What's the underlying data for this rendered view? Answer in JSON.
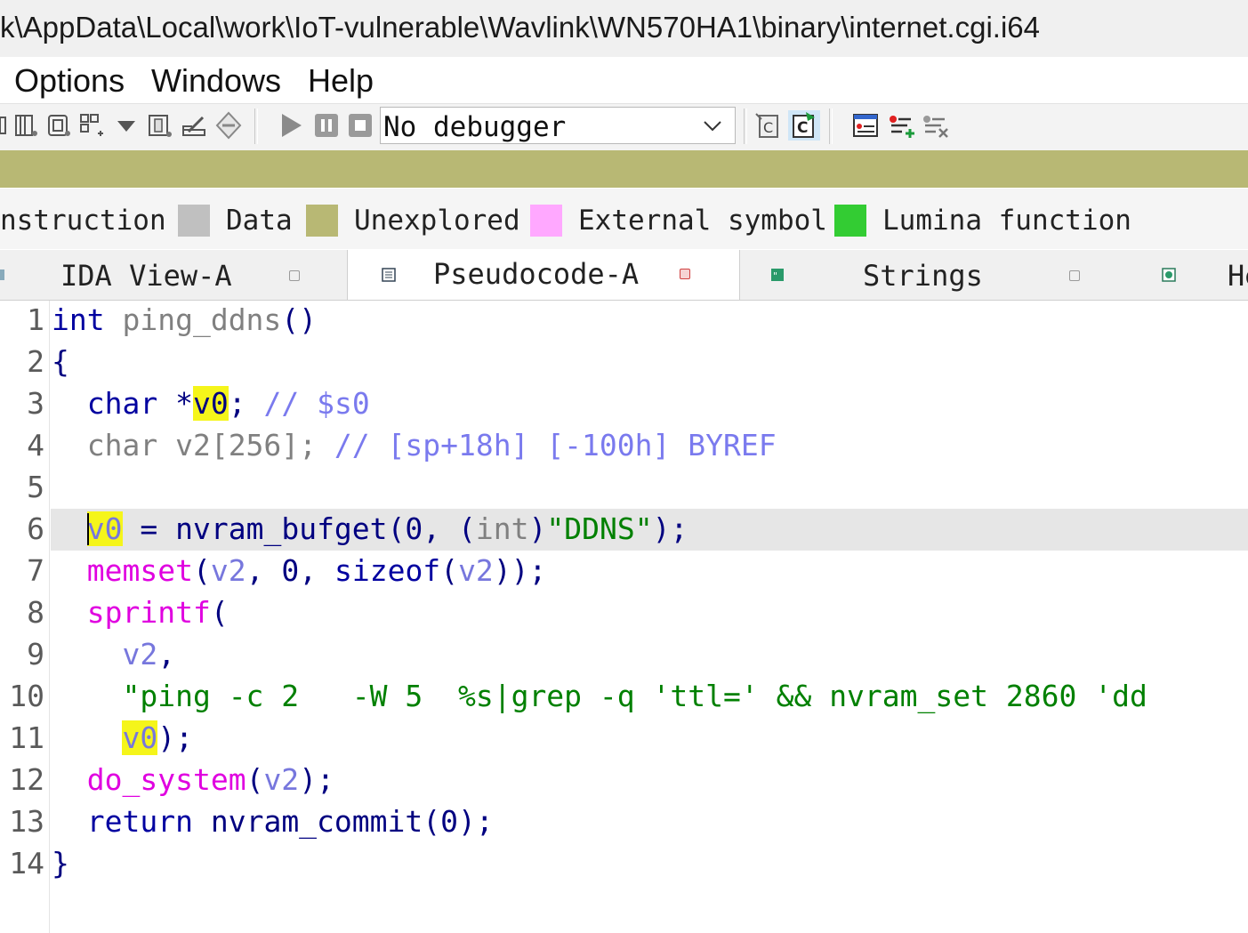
{
  "window": {
    "title": "k\\AppData\\Local\\work\\IoT-vulnerable\\Wavlink\\WN570HA1\\binary\\internet.cgi.i64"
  },
  "menu": [
    "Options",
    "Windows",
    "Help"
  ],
  "toolbar": {
    "debugger_select": "No debugger"
  },
  "legend": {
    "items": [
      {
        "label": "nstruction",
        "color": ""
      },
      {
        "label": "Data",
        "color": "#c0c0c0"
      },
      {
        "label": "Unexplored",
        "color": "#b8b874"
      },
      {
        "label": "External symbol",
        "color": "#ffa8ff"
      },
      {
        "label": "Lumina function",
        "color": "#33cc33"
      }
    ]
  },
  "tabs": [
    {
      "label": "IDA View-A",
      "active": false
    },
    {
      "label": "Pseudocode-A",
      "active": true
    },
    {
      "label": "Strings",
      "active": false
    },
    {
      "label": "He",
      "active": false
    }
  ],
  "code": {
    "line_numbers": [
      "1",
      "2",
      "3",
      "4",
      "5",
      "6",
      "7",
      "8",
      "9",
      "10",
      "11",
      "12",
      "13",
      "14"
    ],
    "l1": {
      "type": "int",
      "name": "ping_ddns",
      "parens": "()"
    },
    "l2": "{",
    "l3": {
      "type": "char",
      "star": "*",
      "var": "v0",
      "semi": ";",
      "comment": "// $s0"
    },
    "l4": {
      "decl": "char v2[256];",
      "comment": "// [sp+18h] [-100h] BYREF"
    },
    "l6": {
      "var": "v0",
      "eq": "=",
      "fn": "nvram_bufget",
      "open": "(",
      "arg0": "0",
      "comma": ",",
      "cast_open": "(",
      "cast": "int",
      "cast_close": ")",
      "str": "\"DDNS\"",
      "close": ");"
    },
    "l7": {
      "fn": "memset",
      "open": "(",
      "a1": "v2",
      "c1": ",",
      "a2": "0",
      "c2": ",",
      "sz": "sizeof",
      "sz_open": "(",
      "a3": "v2",
      "close": "));"
    },
    "l8": {
      "fn": "sprintf",
      "open": "("
    },
    "l9": {
      "arg": "v2",
      "comma": ","
    },
    "l10": {
      "str": "\"ping -c 2   -W 5  %s|grep -q 'ttl=' && nvram_set 2860 'dd"
    },
    "l11": {
      "var": "v0",
      "close": ");"
    },
    "l12": {
      "fn": "do_system",
      "open": "(",
      "arg": "v2",
      "close": ");"
    },
    "l13": {
      "kw": "return",
      "fn": "nvram_commit",
      "args": "(0);"
    },
    "l14": "}"
  }
}
